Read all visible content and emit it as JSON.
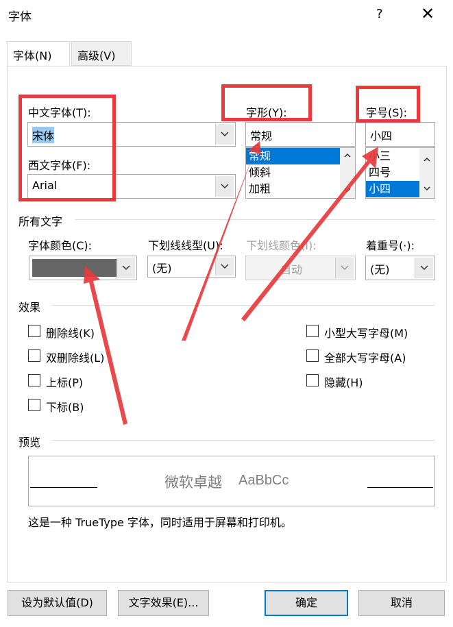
{
  "window": {
    "title": "字体",
    "help": "?",
    "close": "✕"
  },
  "tabs": [
    {
      "label": "字体(N)"
    },
    {
      "label": "高级(V)"
    }
  ],
  "chinese_font": {
    "label": "中文字体(T):",
    "value": "宋体"
  },
  "western_font": {
    "label": "西文字体(F):",
    "value": "Arial"
  },
  "style": {
    "label": "字形(Y):",
    "value": "常规",
    "options": [
      "常规",
      "倾斜",
      "加粗"
    ],
    "selected_index": 0
  },
  "size": {
    "label": "字号(S):",
    "value": "小四",
    "options": [
      "小三",
      "四号",
      "小四"
    ],
    "selected_index": 2
  },
  "all_text": {
    "heading": "所有文字",
    "font_color": {
      "label": "字体颜色(C):",
      "swatch": "#666666"
    },
    "underline_style": {
      "label": "下划线线型(U):",
      "value": "(无)"
    },
    "underline_color": {
      "label": "下划线颜色(I):",
      "value": "自动"
    },
    "emphasis": {
      "label": "着重号(·):",
      "value": "(无)"
    }
  },
  "effects": {
    "heading": "效果",
    "left": [
      "删除线(K)",
      "双删除线(L)",
      "上标(P)",
      "下标(B)"
    ],
    "right": [
      "小型大写字母(M)",
      "全部大写字母(A)",
      "隐藏(H)"
    ]
  },
  "preview": {
    "heading": "预览",
    "sample_cn": "微软卓越",
    "sample_en": "AaBbCc",
    "note": "这是一种 TrueType 字体，同时适用于屏幕和打印机。"
  },
  "buttons": {
    "set_default": "设为默认值(D)",
    "text_effects": "文字效果(E)...",
    "ok": "确定",
    "cancel": "取消"
  },
  "colors": {
    "accent": "#0078d7",
    "annotation": "#e8393c"
  }
}
